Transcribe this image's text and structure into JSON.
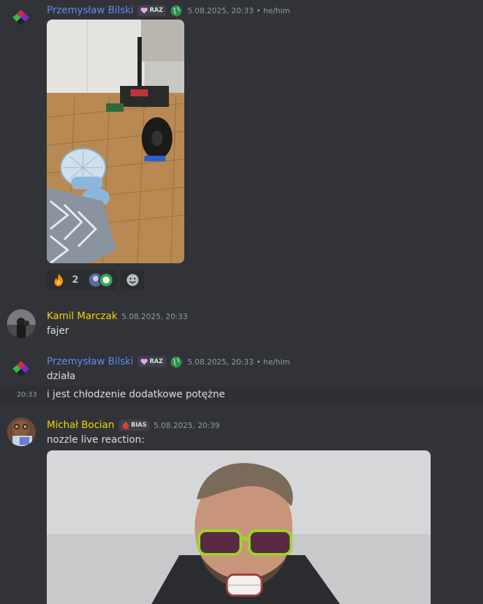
{
  "messages": [
    {
      "author": "Przemysław Bilski",
      "tag": "RAZ",
      "timestamp": "5.08.2025, 20:33",
      "pronouns": "• he/him",
      "reactions": [
        {
          "emoji": "fire-emoji",
          "count": "2"
        }
      ]
    },
    {
      "author": "Kamil Marczak",
      "timestamp": "5.08.2025, 20:33",
      "text": "fajer"
    },
    {
      "author": "Przemysław Bilski",
      "tag": "RAZ",
      "timestamp": "5.08.2025, 20:33",
      "pronouns": "• he/him",
      "text": "działa"
    },
    {
      "hover_time": "20:33",
      "text": "i jest chłodzenie dodatkowe potężne"
    },
    {
      "author": "Michał Bocian",
      "tag": "BIAS",
      "timestamp": "5.08.2025, 20:39",
      "text": "nozzle live reaction:"
    }
  ],
  "colors": {
    "background": "#313338",
    "name_blue": "#5d8cf0",
    "name_yellow": "#f5d600",
    "hover_row": "#2e3035"
  }
}
